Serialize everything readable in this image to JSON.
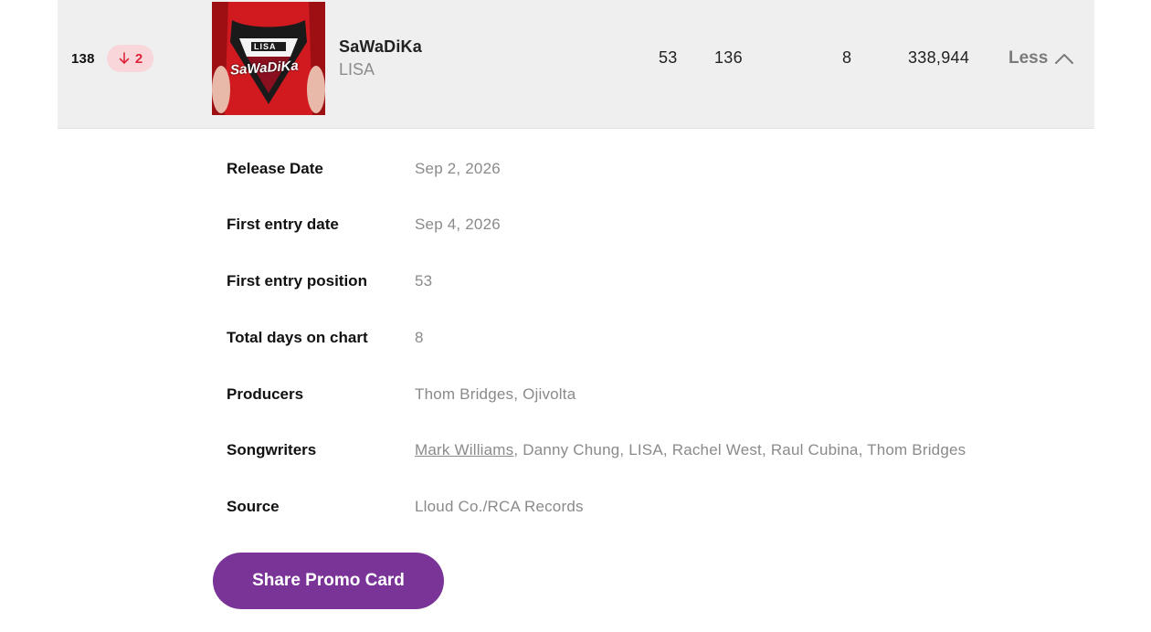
{
  "chart_row": {
    "rank": "138",
    "movement": {
      "direction": "down",
      "value": "2",
      "color": "#e0243a"
    },
    "cover_text": "SaWaDiKa",
    "cover_brand": "LISA",
    "title": "SaWaDiKa",
    "artist": "LISA",
    "stats": {
      "peak": "53",
      "previous": "136",
      "days": "8",
      "streams": "338,944"
    },
    "toggle_label": "Less"
  },
  "details": [
    {
      "label": "Release Date",
      "value": "Sep 2, 2026"
    },
    {
      "label": "First entry date",
      "value": "Sep 4, 2026"
    },
    {
      "label": "First entry position",
      "value": "53"
    },
    {
      "label": "Total days on chart",
      "value": "8"
    },
    {
      "label": "Producers",
      "value": "Thom Bridges, Ojivolta"
    },
    {
      "label": "Songwriters",
      "link": "Mark Williams",
      "rest": ", Danny Chung, LISA, Rachel West, Raul Cubina, Thom Bridges"
    },
    {
      "label": "Source",
      "value": "Lloud Co./RCA Records"
    }
  ],
  "share_button": "Share Promo Card",
  "colors": {
    "accent": "#7a3397",
    "row_bg": "#efefef",
    "down": "#e0243a"
  }
}
